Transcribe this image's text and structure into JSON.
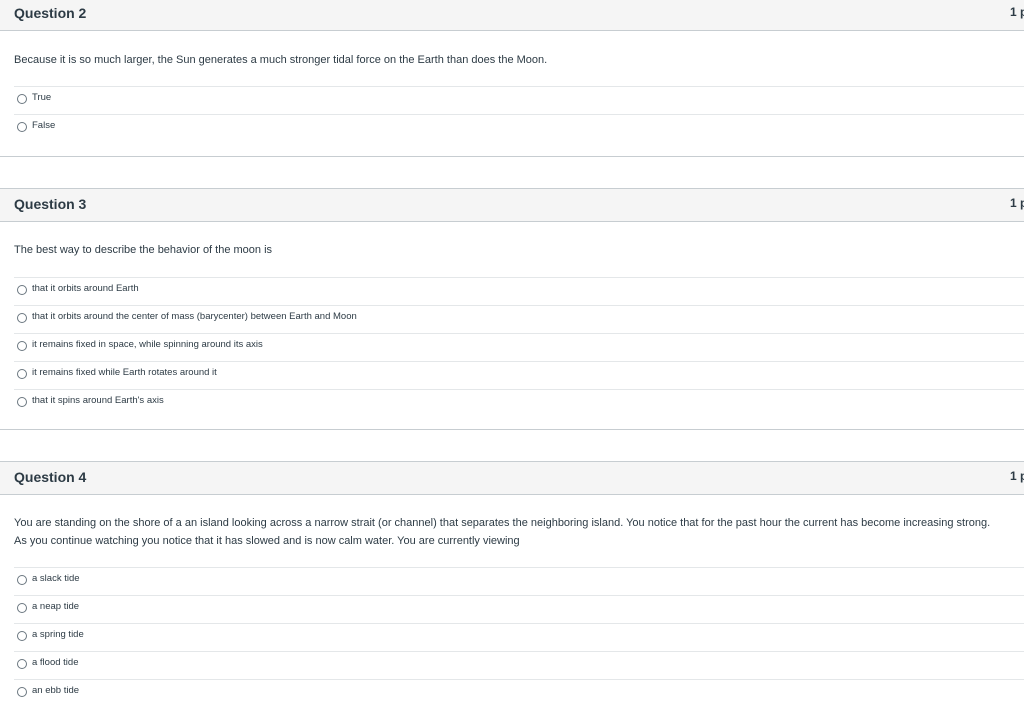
{
  "questions": [
    {
      "title": "Question 2",
      "points": "1 p",
      "text": "Because it is so much larger, the Sun generates a much stronger tidal force on the Earth than does the Moon.",
      "answers": [
        "True",
        "False"
      ]
    },
    {
      "title": "Question 3",
      "points": "1 p",
      "text": "The best way to describe the behavior of the moon is",
      "answers": [
        "that it orbits around Earth",
        "that it orbits around the center of mass (barycenter) between Earth and Moon",
        "it remains fixed in space, while spinning around its axis",
        "it remains fixed while Earth rotates around it",
        "that it spins around Earth's axis"
      ]
    },
    {
      "title": "Question 4",
      "points": "1 p",
      "text_line1": "You are standing on the shore of a an island looking across a narrow strait (or channel) that separates the neighboring island. You notice that for the past hour the current has become increasing strong.",
      "text_line2": "As you continue watching you notice that it has slowed and is now calm water.  You are currently viewing",
      "answers": [
        "a slack tide",
        "a neap tide",
        "a spring tide",
        "a flood tide",
        "an ebb tide"
      ]
    }
  ]
}
